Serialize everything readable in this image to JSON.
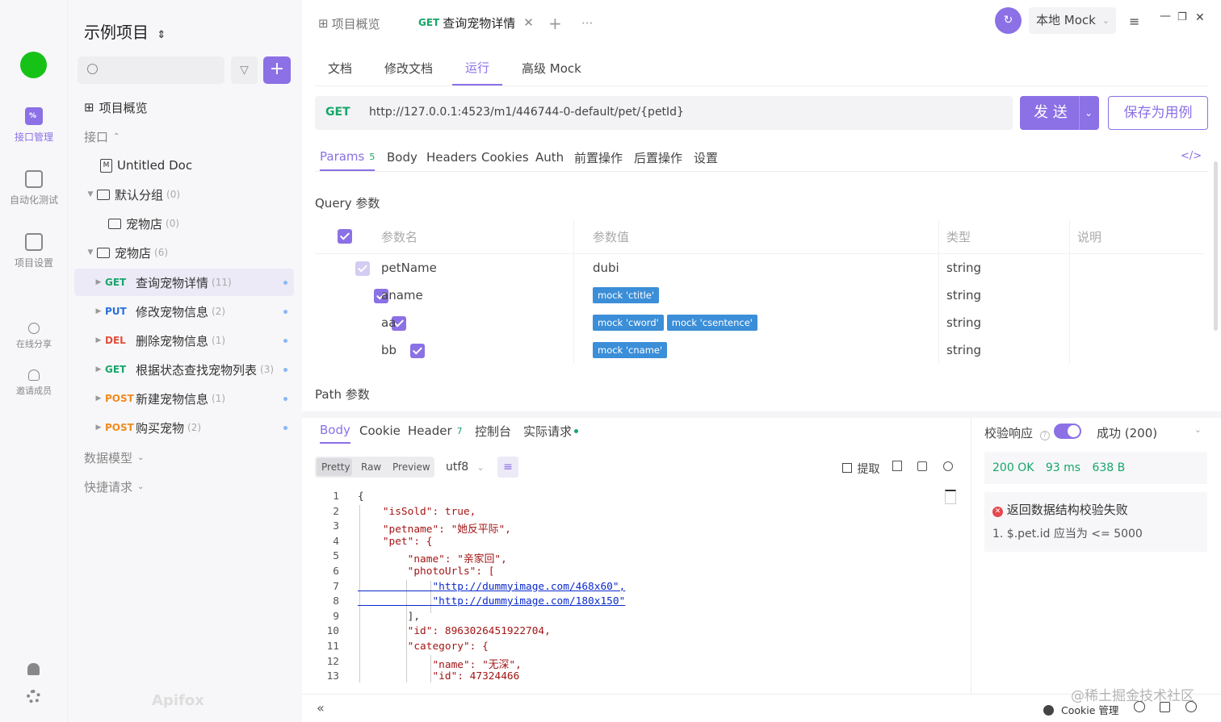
{
  "rail": {
    "items": [
      {
        "label": "接口管理"
      },
      {
        "label": "自动化测试"
      },
      {
        "label": "项目设置"
      },
      {
        "label": "在线分享"
      },
      {
        "label": "邀请成员"
      }
    ]
  },
  "sidebar": {
    "project_title": "示例项目",
    "overview": "项目概览",
    "interfaces_label": "接口",
    "untitled_doc": "Untitled Doc",
    "default_group": "默认分组",
    "default_group_count": "(0)",
    "pet_shop_sub": "宠物店",
    "pet_shop_sub_count": "(0)",
    "pet_shop": "宠物店",
    "pet_shop_count": "(6)",
    "endpoints": [
      {
        "method": "GET",
        "name": "查询宠物详情",
        "count": "(11)"
      },
      {
        "method": "PUT",
        "name": "修改宠物信息",
        "count": "(2)"
      },
      {
        "method": "DEL",
        "name": "删除宠物信息",
        "count": "(1)"
      },
      {
        "method": "GET",
        "name": "根据状态查找宠物列表",
        "count": "(3)"
      },
      {
        "method": "POST",
        "name": "新建宠物信息",
        "count": "(1)"
      },
      {
        "method": "POST",
        "name": "购买宠物",
        "count": "(2)"
      }
    ],
    "data_model": "数据模型",
    "quick_request": "快捷请求",
    "brand": "Apifox"
  },
  "topbar": {
    "tab_overview": "项目概览",
    "tab_active_method": "GET",
    "tab_active_name": "查询宠物详情",
    "env": "本地 Mock"
  },
  "subtabs": [
    "文档",
    "修改文档",
    "运行",
    "高级 Mock"
  ],
  "request": {
    "method": "GET",
    "url": "http://127.0.0.1:4523/m1/446744-0-default/pet/{petId}",
    "send": "发 送",
    "save": "保存为用例"
  },
  "param_tabs": {
    "params": "Params",
    "params_count": "5",
    "others": [
      "Body",
      "Headers",
      "Cookies",
      "Auth",
      "前置操作",
      "后置操作",
      "设置"
    ]
  },
  "query": {
    "title": "Query 参数",
    "headers": [
      "参数名",
      "参数值",
      "类型",
      "说明"
    ],
    "rows": [
      {
        "name": "petName",
        "value": "dubi",
        "type": "string"
      },
      {
        "name": "aname",
        "mocks": [
          "mock 'ctitle'"
        ],
        "type": "string"
      },
      {
        "name": "aa",
        "mocks": [
          "mock 'cword'",
          "mock 'csentence'"
        ],
        "type": "string"
      },
      {
        "name": "bb",
        "mocks": [
          "mock 'cname'"
        ],
        "type": "string"
      }
    ],
    "path_title": "Path 参数"
  },
  "response": {
    "tabs": [
      "Body",
      "Cookie",
      "Header",
      "控制台",
      "实际请求"
    ],
    "header_count": "7",
    "views": [
      "Pretty",
      "Raw",
      "Preview"
    ],
    "encoding": "utf8",
    "extract": "提取",
    "code": [
      "{",
      "    \"isSold\": true,",
      "    \"petname\": \"她反平际\",",
      "    \"pet\": {",
      "        \"name\": \"亲家回\",",
      "        \"photoUrls\": [",
      "            \"http://dummyimage.com/468x60\",",
      "            \"http://dummyimage.com/180x150\"",
      "        ],",
      "        \"id\": 8963026451922704,",
      "        \"category\": {",
      "            \"name\": \"无深\",",
      "            \"id\": 47324466"
    ]
  },
  "validation": {
    "label": "校验响应",
    "status": "成功 (200)",
    "ok": "200 OK",
    "time": "93 ms",
    "size": "638 B",
    "error_title": "返回数据结构校验失败",
    "error_detail": "1. $.pet.id 应当为 <= 5000"
  },
  "footer": {
    "cookie": "Cookie 管理",
    "watermark": "@稀土掘金技术社区"
  },
  "colors": {
    "accent": "#8b70e6",
    "get": "#17a669",
    "put": "#2a6fdb",
    "del": "#e04f3b",
    "post": "#f18a1b"
  }
}
